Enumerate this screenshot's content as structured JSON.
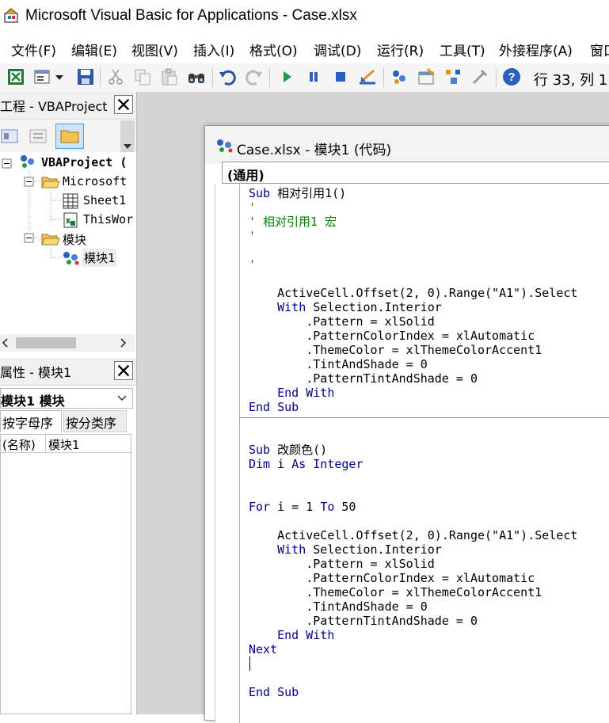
{
  "window": {
    "title": "Microsoft Visual Basic for Applications - Case.xlsx"
  },
  "menu": [
    {
      "label": "文件(F)"
    },
    {
      "label": "编辑(E)"
    },
    {
      "label": "视图(V)"
    },
    {
      "label": "插入(I)"
    },
    {
      "label": "格式(O)"
    },
    {
      "label": "调试(D)"
    },
    {
      "label": "运行(R)"
    },
    {
      "label": "工具(T)"
    },
    {
      "label": "外接程序(A)"
    },
    {
      "label": "窗口"
    }
  ],
  "toolbar": {
    "position_readout": "行 33, 列 1",
    "buttons": [
      "view-excel-icon",
      "insert-module-icon",
      "save-icon",
      "cut-icon",
      "copy-icon",
      "paste-icon",
      "find-icon",
      "undo-icon",
      "redo-icon",
      "run-icon",
      "break-icon",
      "reset-icon",
      "design-mode-icon",
      "project-explorer-icon",
      "properties-icon",
      "object-browser-icon",
      "toolbox-icon",
      "help-icon"
    ]
  },
  "project_pane": {
    "title": "工程 - VBAProject",
    "tree": {
      "root": "VBAProject (",
      "microsoft_folder": "Microsoft",
      "sheet1": "Sheet1",
      "thisworkbook": "ThisWor",
      "modules_folder": "模块",
      "module1": "模块1"
    }
  },
  "props_pane": {
    "title": "属性 - 模块1",
    "selected_object": "模块1 模块",
    "tab_alpha": "按字母序",
    "tab_category": "按分类序",
    "prop_name": "(名称)",
    "prop_value": "模块1"
  },
  "code_window": {
    "title": "Case.xlsx - 模块1 (代码)",
    "object_box": "(通用)",
    "lines": [
      {
        "text": "Sub 相对引用1()",
        "style": "mixed1"
      },
      {
        "text": "'",
        "style": "cm"
      },
      {
        "text": "' 相对引用1 宏",
        "style": "cm"
      },
      {
        "text": "'",
        "style": "cm"
      },
      {
        "text": "",
        "style": "plain"
      },
      {
        "text": "'",
        "style": "cm"
      },
      {
        "text": "",
        "style": "plain"
      },
      {
        "text": "    ActiveCell.Offset(2, 0).Range(\"A1\").Select",
        "style": "plain"
      },
      {
        "text": "    With Selection.Interior",
        "style": "with"
      },
      {
        "text": "        .Pattern = xlSolid",
        "style": "plain"
      },
      {
        "text": "        .PatternColorIndex = xlAutomatic",
        "style": "plain"
      },
      {
        "text": "        .ThemeColor = xlThemeColorAccent1",
        "style": "plain"
      },
      {
        "text": "        .TintAndShade = 0",
        "style": "plain"
      },
      {
        "text": "        .PatternTintAndShade = 0",
        "style": "plain"
      },
      {
        "text": "    End With",
        "style": "kw"
      },
      {
        "text": "End Sub",
        "style": "kw"
      },
      {
        "text": "",
        "style": "plain"
      },
      {
        "text": "",
        "style": "plain"
      },
      {
        "text": "Sub 改颜色()",
        "style": "mixed1"
      },
      {
        "text": "Dim i As Integer",
        "style": "kw"
      },
      {
        "text": "",
        "style": "plain"
      },
      {
        "text": "",
        "style": "plain"
      },
      {
        "text": "For i = 1 To 50",
        "style": "for"
      },
      {
        "text": "",
        "style": "plain"
      },
      {
        "text": "    ActiveCell.Offset(2, 0).Range(\"A1\").Select",
        "style": "plain"
      },
      {
        "text": "    With Selection.Interior",
        "style": "with"
      },
      {
        "text": "        .Pattern = xlSolid",
        "style": "plain"
      },
      {
        "text": "        .PatternColorIndex = xlAutomatic",
        "style": "plain"
      },
      {
        "text": "        .ThemeColor = xlThemeColorAccent1",
        "style": "plain"
      },
      {
        "text": "        .TintAndShade = 0",
        "style": "plain"
      },
      {
        "text": "        .PatternTintAndShade = 0",
        "style": "plain"
      },
      {
        "text": "    End With",
        "style": "kw"
      },
      {
        "text": "Next",
        "style": "kw"
      },
      {
        "text": "",
        "style": "plain"
      },
      {
        "text": "",
        "style": "plain"
      },
      {
        "text": "End Sub",
        "style": "kw"
      }
    ]
  },
  "colors": {
    "keyword": "#00008b",
    "comment": "#008000",
    "workspace": "#d4d4d4"
  }
}
